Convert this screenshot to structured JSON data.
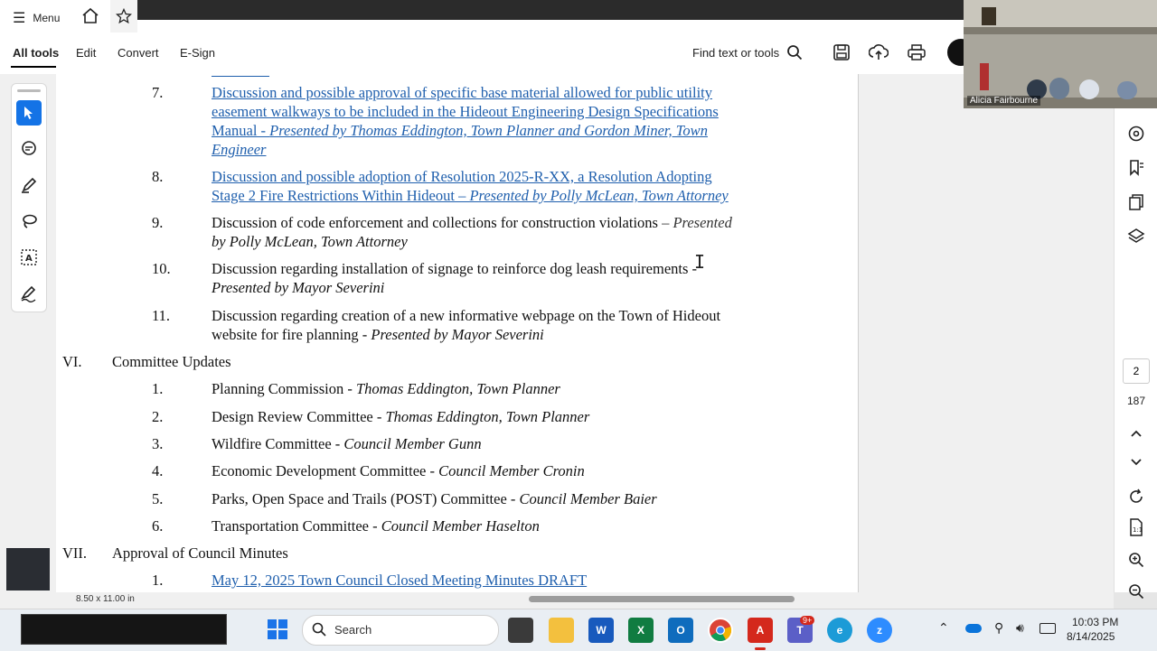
{
  "menu": {
    "menu_label": "Menu"
  },
  "toolbar": {
    "all_tools": "All tools",
    "edit": "Edit",
    "convert": "Convert",
    "esign": "E-Sign",
    "find_label": "Find text or tools"
  },
  "document": {
    "items": [
      {
        "num": "7.",
        "link_text_l1": "Discussion and possible approval of specific base material allowed for public utility",
        "link_text_l2": "easement walkways to be included in the Hideout Engineering Design Specifications",
        "link_text_l3a": "Manual - ",
        "link_text_l3b": "Presented by Thomas Eddington, Town Planner and Gordon Miner, Town",
        "link_text_l4": "Engineer"
      },
      {
        "num": "8.",
        "link_text_l1": "Discussion and possible adoption of Resolution 2025-R-XX, a Resolution Adopting",
        "link_text_l2a": "Stage 2 Fire Restrictions Within Hideout – ",
        "link_text_l2b": "Presented by Polly McLean, Town Attorney"
      },
      {
        "num": "9.",
        "text_l1": "Discussion of code enforcement and collections for construction violations",
        "text_l1b": " – Presented",
        "text_l2": "by Polly McLean, Town Attorney"
      },
      {
        "num": "10.",
        "text_l1": "Discussion regarding installation of signage to reinforce dog leash requirements -",
        "text_l2": "Presented by Mayor Severini"
      },
      {
        "num": "11.",
        "text_l1": "Discussion regarding creation of a new informative webpage on the Town of Hideout",
        "text_l2a": "website for fire planning - ",
        "text_l2b": "Presented by Mayor Severini"
      }
    ],
    "section_vi": {
      "num": "VI.",
      "title": "Committee Updates"
    },
    "committees": [
      {
        "num": "1.",
        "name": "Planning Commission - ",
        "who": "Thomas Eddington, Town Planner"
      },
      {
        "num": "2.",
        "name": "Design Review Committee - ",
        "who": "Thomas Eddington, Town Planner"
      },
      {
        "num": "3.",
        "name": "Wildfire Committee - ",
        "who": "Council Member Gunn"
      },
      {
        "num": "4.",
        "name": "Economic Development Committee - ",
        "who": "Council Member Cronin"
      },
      {
        "num": "5.",
        "name": "Parks, Open Space and Trails (POST) Committee - ",
        "who": "Council Member Baier"
      },
      {
        "num": "6.",
        "name": "Transportation Committee - ",
        "who": "Council Member Haselton"
      }
    ],
    "section_vii": {
      "num": "VII.",
      "title": "Approval of Council Minutes"
    },
    "minutes": [
      {
        "num": "1.",
        "text": "May 12, 2025 Town Council Closed Meeting Minutes DRAFT"
      }
    ]
  },
  "right_panel": {
    "page_number": "2",
    "page_count": "187"
  },
  "status": {
    "page_size": "8.50 x 11.00 in"
  },
  "video": {
    "participant_name": "Alicia Fairbourne"
  },
  "taskbar": {
    "search_placeholder": "Search",
    "time": "10:03 PM",
    "date": "8/14/2025",
    "teams_badge": "9+"
  },
  "colors": {
    "link": "#1f5fad",
    "accent": "#1473e6",
    "acrobat_red": "#d4281c"
  },
  "icons": [
    "hamburger-icon",
    "home-icon",
    "star-icon",
    "search-icon",
    "save-icon",
    "upload-icon",
    "print-icon",
    "select-icon",
    "comment-icon",
    "pen-icon",
    "lasso-icon",
    "text-select-icon",
    "sign-icon",
    "windows-icon",
    "folder-icon",
    "word-icon",
    "excel-icon",
    "outlook-icon",
    "chrome-icon",
    "acrobat-icon",
    "teams-icon",
    "edge-icon",
    "zoom-icon"
  ]
}
